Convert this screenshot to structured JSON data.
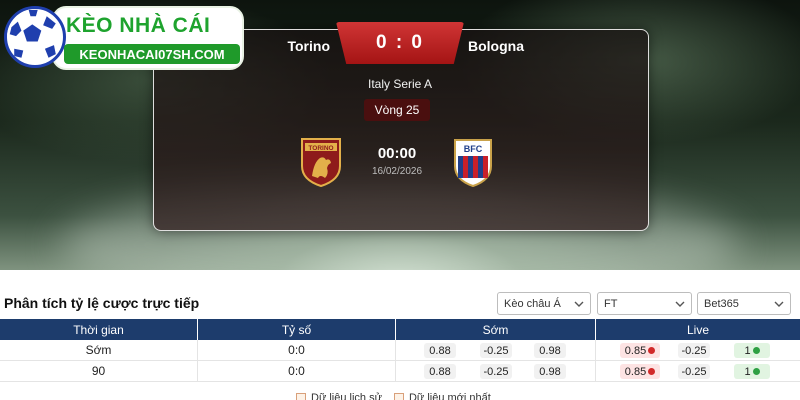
{
  "site": {
    "brand_title": "KÈO NHÀ CÁI",
    "brand_domain": "KEONHACAI07SH.COM"
  },
  "match": {
    "home_team": "Torino",
    "away_team": "Bologna",
    "score": "0 : 0",
    "league": "Italy Serie A",
    "round": "Vòng 25",
    "kickoff_time": "00:00",
    "date": "16/02/2026",
    "home_crest_text": "TORINO",
    "away_crest_text": "BFC"
  },
  "odds_section": {
    "title": "Phân tích tỷ lệ cược trực tiếp",
    "filters": {
      "market": "Kèo châu Á",
      "period": "FT",
      "bookmaker": "Bet365"
    },
    "columns": {
      "time": "Thời gian",
      "score": "Tỷ số",
      "early": "Sớm",
      "live": "Live"
    },
    "rows": [
      {
        "time": "Sớm",
        "score": "0:0",
        "early": [
          "0.88",
          "-0.25",
          "0.98"
        ],
        "live": [
          "0.85",
          "-0.25",
          "1"
        ]
      },
      {
        "time": "90",
        "score": "0:0",
        "early": [
          "0.88",
          "-0.25",
          "0.98"
        ],
        "live": [
          "0.85",
          "-0.25",
          "1"
        ]
      }
    ],
    "legend": [
      "Dữ liệu lịch sử",
      "Dữ liệu mới nhất"
    ]
  },
  "colors": {
    "header_navy": "#1d3c6c",
    "score_red": "#b81c1c",
    "brand_green": "#1ea32e",
    "odds_down": "#d12a2a",
    "odds_up": "#2ea043"
  }
}
